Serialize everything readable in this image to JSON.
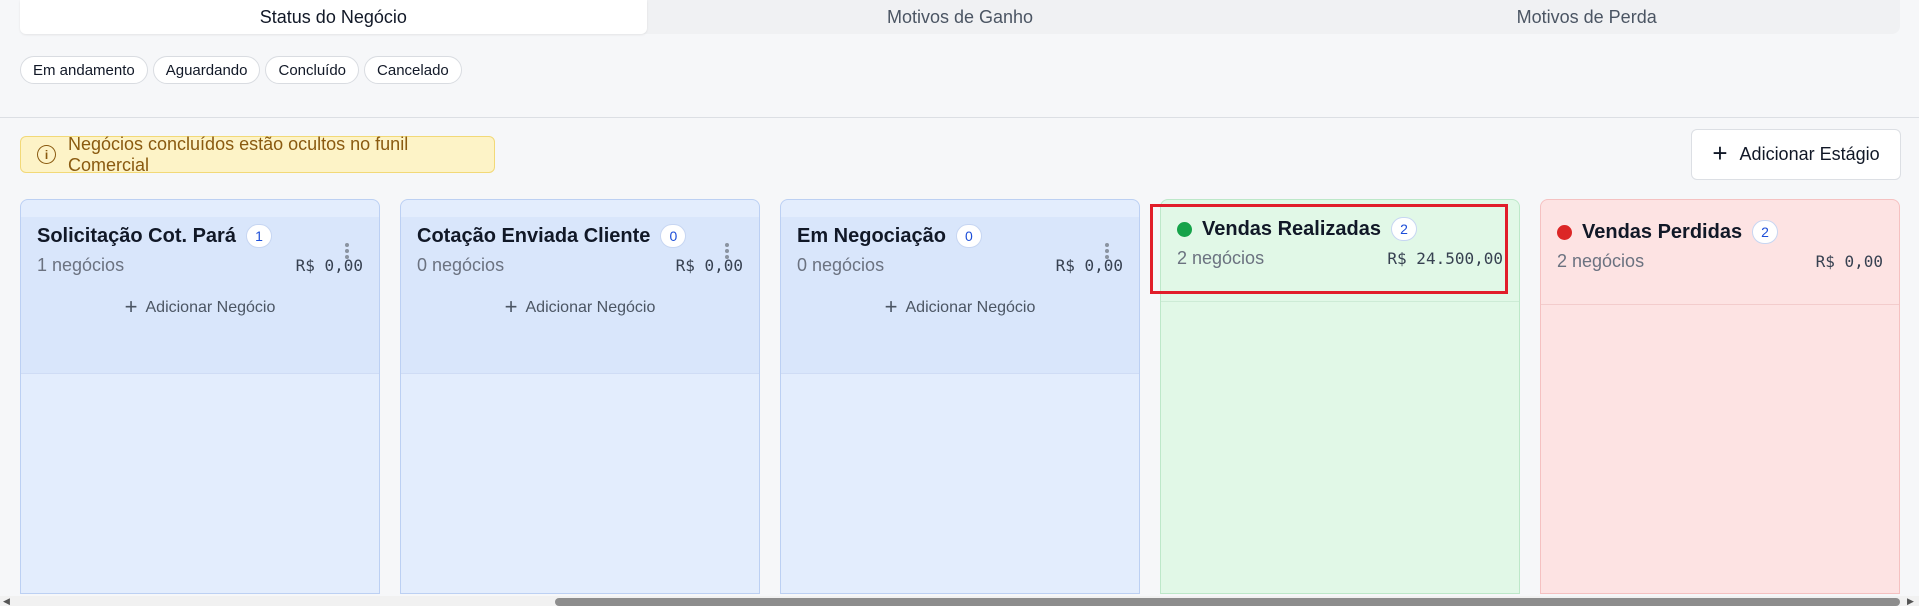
{
  "tabs": [
    {
      "label": "Status do Negócio",
      "active": true
    },
    {
      "label": "Motivos de Ganho",
      "active": false
    },
    {
      "label": "Motivos de Perda",
      "active": false
    }
  ],
  "filters": [
    "Em andamento",
    "Aguardando",
    "Concluído",
    "Cancelado"
  ],
  "alert": {
    "text": "Negócios concluídos estão ocultos no funil Comercial",
    "icon": "info-icon"
  },
  "add_stage": {
    "label": "Adicionar Estágio",
    "icon": "plus-icon"
  },
  "columns": [
    {
      "title": "Solicitação Cot. Pará",
      "badge": "1",
      "count": "1 negócios",
      "amount": "R$ 0,00",
      "add_label": "Adicionar Negócio",
      "type": "blue"
    },
    {
      "title": "Cotação Enviada Cliente",
      "badge": "0",
      "count": "0 negócios",
      "amount": "R$ 0,00",
      "add_label": "Adicionar Negócio",
      "type": "blue"
    },
    {
      "title": "Em Negociação",
      "badge": "0",
      "count": "0 negócios",
      "amount": "R$ 0,00",
      "add_label": "Adicionar Negócio",
      "type": "blue"
    },
    {
      "title": "Vendas Realizadas",
      "badge": "2",
      "count": "2 negócios",
      "amount": "R$ 24.500,00",
      "type": "green",
      "dot_color": "#16a34a"
    },
    {
      "title": "Vendas Perdidas",
      "badge": "2",
      "count": "2 negócios",
      "amount": "R$ 0,00",
      "type": "red",
      "dot_color": "#dc2626"
    }
  ],
  "colors": {
    "alert_bg": "#fdf3c7",
    "highlight": "#e11d2a",
    "won": "#16a34a",
    "lost": "#dc2626"
  }
}
